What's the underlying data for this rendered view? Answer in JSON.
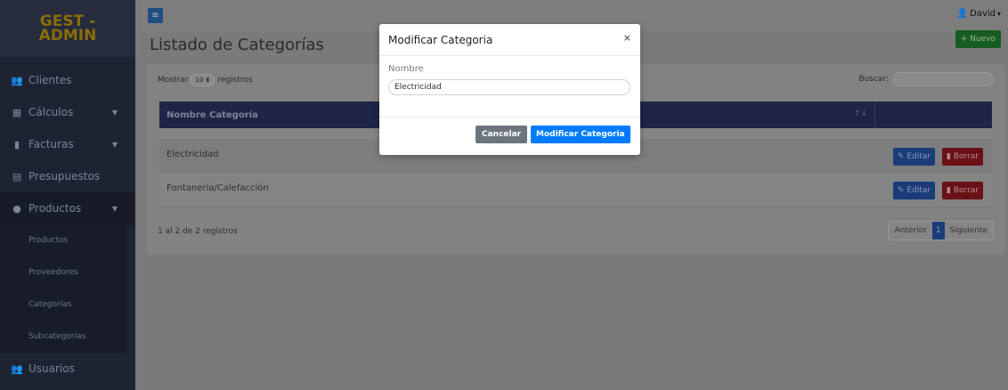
{
  "brand": {
    "line1": "GEST -",
    "line2": "ADMIN"
  },
  "sidebar": {
    "items": [
      {
        "label": "Clientes",
        "icon": "users-icon"
      },
      {
        "label": "Cálculos",
        "icon": "calculator-icon"
      },
      {
        "label": "Facturas",
        "icon": "file-icon"
      },
      {
        "label": "Presupuestos",
        "icon": "document-icon"
      },
      {
        "label": "Productos",
        "icon": "product-icon"
      },
      {
        "label": "Usuarios",
        "icon": "user-group-icon"
      }
    ],
    "sub_items": [
      "Productos",
      "Proveedores",
      "Categorías",
      "Subcategorías"
    ]
  },
  "topbar": {
    "user": "David"
  },
  "page": {
    "title": "Listado de Categorías",
    "new_button": "+ Nuevo"
  },
  "table": {
    "show_prefix": "Mostrar",
    "show_value": "10",
    "show_suffix": "registros",
    "search_label": "Buscar:",
    "header": "Nombre Categoría",
    "rows": [
      {
        "name": "Electricidad"
      },
      {
        "name": "Fontanería/Calefacción"
      }
    ],
    "edit_label": "Editar",
    "delete_label": "Borrar",
    "info": "1 al 2 de 2 registros",
    "pager": {
      "prev": "Anterior",
      "page": "1",
      "next": "Siguiente"
    }
  },
  "modal": {
    "title": "Modificar Categoria",
    "field_label": "Nombre",
    "field_value": "Electricidad",
    "cancel": "Cancelar",
    "submit": "Modificar Categoria"
  }
}
